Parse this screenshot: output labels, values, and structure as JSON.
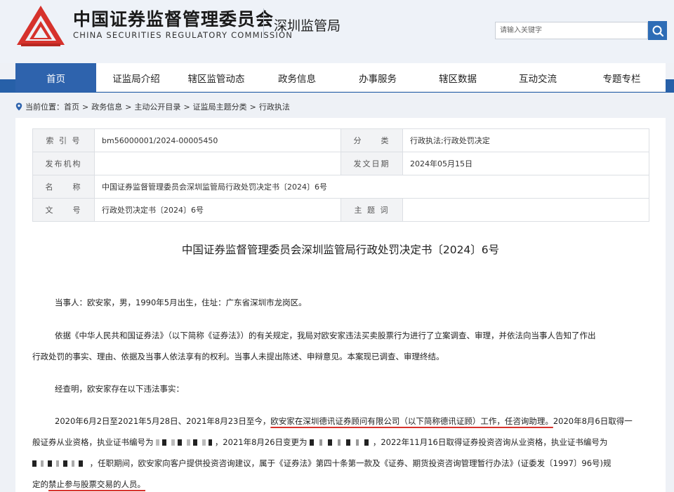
{
  "header": {
    "brand_cn": "中国证券监督管理委员会",
    "brand_en": "CHINA SECURITIES REGULATORY COMMISSION",
    "bureau": "深圳监管局",
    "search_placeholder": "请输入关键字",
    "logo_icon": "csrc-logo-icon",
    "search_icon": "search-icon",
    "accent": "#2e63ad",
    "logo_color": "#d6322c"
  },
  "nav": {
    "items": [
      {
        "label": "首页",
        "active": true
      },
      {
        "label": "证监局介绍"
      },
      {
        "label": "辖区监管动态"
      },
      {
        "label": "政务信息"
      },
      {
        "label": "办事服务"
      },
      {
        "label": "辖区数据"
      },
      {
        "label": "互动交流"
      },
      {
        "label": "专题专栏"
      }
    ]
  },
  "breadcrumb": {
    "prefix": "当前位置：",
    "path": [
      "首页",
      "政务信息",
      "主动公开目录",
      "证监局主题分类",
      "行政执法"
    ],
    "separator": ">"
  },
  "meta": {
    "index_label": "索 引 号",
    "index_value": "bm56000001/2024-00005450",
    "category_label": "分　　类",
    "category_value": "行政执法;行政处罚决定",
    "issuer_label": "发布机构",
    "issuer_value": "",
    "date_label": "发文日期",
    "date_value": "2024年05月15日",
    "name_label": "名　　称",
    "name_value": "中国证券监督管理委员会深圳监管局行政处罚决定书〔2024〕6号",
    "docno_label": "文　　号",
    "docno_value": "行政处罚决定书〔2024〕6号",
    "subject_label": "主 题 词",
    "subject_value": ""
  },
  "doc": {
    "title": "中国证券监督管理委员会深圳监管局行政处罚决定书〔2024〕6号",
    "p1": "当事人：欧安家，男，1990年5月出生，住址：广东省深圳市龙岗区。",
    "p2_line1": "依据《中华人民共和国证券法》（以下简称《证券法》）的有关规定，我局对欧安家违法买卖股票行为进行了立案调查、审理，并依法向当事人告知了作出",
    "p2_line2": "行政处罚的事实、理由、依据及当事人依法享有的权利。当事人未提出陈述、申辩意见。本案现已调查、审理终结。",
    "p3": "经查明，欧安家存在以下违法事实：",
    "p4_a": "2020年6月2日至2021年5月28日、2021年8月23日至今，",
    "p4_b": "欧安家在深圳德讯证券顾问有限公司（以下简称德讯证顾）工作，任咨询助理。",
    "p4_c": "2020年8月6日取得一",
    "p5_a": "般证券从业资格，执业证书编号为",
    "p5_b": "，2021年8月26日变更为",
    "p5_c": "，2022年11月16日取得证券投资咨询从业资格，执业证书编号为",
    "p6": "，任职期间，欧安家向客户提供投资咨询建议，属于《证券法》第四十条第一款及《证券、期货投资咨询管理暂行办法》(证委发〔1997〕96号)规",
    "p7_a": "定的",
    "p7_b": "禁止参与股票交易的人员。"
  }
}
